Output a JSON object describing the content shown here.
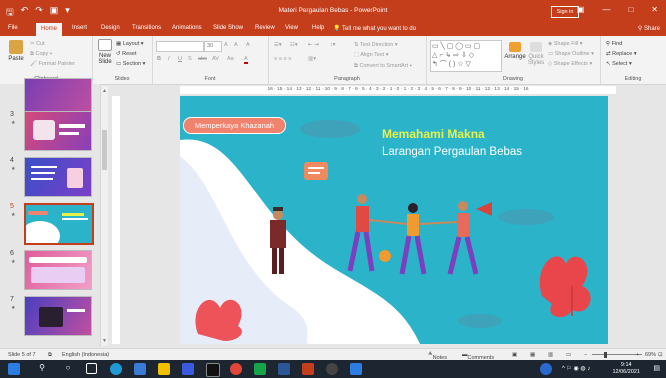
{
  "window": {
    "title": "Materi Pergaulan Bebas  -  PowerPoint",
    "sign_in": "Sign in",
    "controls": {
      "ribbon_display": "▣",
      "minimize": "—",
      "maximize": "□",
      "close": "✕"
    }
  },
  "quick_access": {
    "save": "🖫",
    "undo": "↶",
    "redo": "↷",
    "present": "▣",
    "customize": "▾"
  },
  "tabs": [
    "File",
    "Home",
    "Insert",
    "Design",
    "Transitions",
    "Animations",
    "Slide Show",
    "Review",
    "View",
    "Help"
  ],
  "active_tab": "Home",
  "tell_me": "Tell me what you want to do",
  "share": "Share",
  "ribbon": {
    "clipboard": {
      "paste": "Paste",
      "cut": "Cut",
      "copy": "Copy",
      "format_painter": "Format Painter",
      "label": "Clipboard"
    },
    "slides": {
      "new_slide": "New",
      "new_slide2": "Slide",
      "layout": "Layout",
      "reset": "Reset",
      "section": "Section",
      "label": "Slides"
    },
    "font": {
      "font_name": "",
      "font_size": "30",
      "increase": "A",
      "decrease": "A",
      "clear": "A",
      "bold": "B",
      "italic": "I",
      "underline": "U",
      "shadow": "S",
      "strike": "abc",
      "spacing": "AV",
      "case": "Aa",
      "color": "A",
      "label": "Font"
    },
    "paragraph": {
      "text_direction": "Text Direction",
      "align_text": "Align Text",
      "smartart": "Convert to SmartArt",
      "label": "Paragraph"
    },
    "drawing": {
      "arrange": "Arrange",
      "quick_styles": "Quick Styles",
      "shape_fill": "Shape Fill",
      "shape_outline": "Shape Outline",
      "shape_effects": "Shape Effects",
      "label": "Drawing"
    },
    "editing": {
      "find": "Find",
      "replace": "Replace",
      "select": "Select",
      "label": "Editing"
    }
  },
  "ruler_text": "16 · 15 · 14 · 13 · 12 · 11 · 10 · 9 · 8 · 7 · 6 · 5 · 4 · 3 · 2 · 1 · 0 · 1 · 2 · 3 · 4 · 5 · 6 · 7 · 8 · 9 · 10 · 11 · 12 · 13 · 14 · 15 · 16",
  "thumbnails": [
    {
      "number": "3",
      "star": "★"
    },
    {
      "number": "4",
      "star": "★"
    },
    {
      "number": "5",
      "star": "★"
    },
    {
      "number": "6",
      "star": "★"
    },
    {
      "number": "7",
      "star": "★"
    }
  ],
  "slide": {
    "badge": "Memperkaya Khazanah",
    "title_line1": "Memahami Makna",
    "title_line2": "Larangan Pergaulan Bebas"
  },
  "status": {
    "slide_count": "Slide 5 of 7",
    "language": "English (Indonesia)",
    "notes": "Notes",
    "comments": "Comments",
    "zoom": "69%"
  },
  "taskbar": {
    "time": "9:14",
    "date": "12/06/2021"
  },
  "colors": {
    "accent": "#c43e1c",
    "slide_bg": "#2bb3c9",
    "title_yellow": "#e6f24a",
    "badge": "#f0836e"
  }
}
